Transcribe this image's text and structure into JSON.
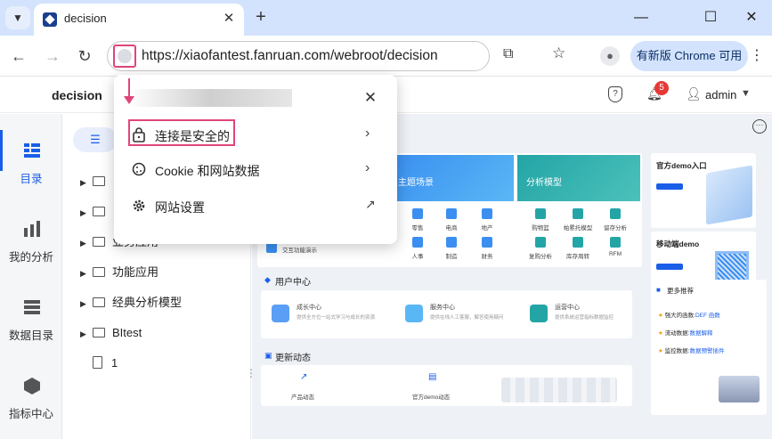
{
  "browser": {
    "tab_title": "decision",
    "url": "https://xiaofantest.fanruan.com/webroot/decision",
    "update_button": "有新版 Chrome 可用"
  },
  "app": {
    "name": "decision",
    "notification_count": "5",
    "user": "admin"
  },
  "leftnav": {
    "items": [
      {
        "label": "目录",
        "icon": "catalog-icon"
      },
      {
        "label": "我的分析",
        "icon": "analysis-icon"
      },
      {
        "label": "数据目录",
        "icon": "data-catalog-icon"
      },
      {
        "label": "指标中心",
        "icon": "metrics-icon"
      }
    ]
  },
  "tree": {
    "items": [
      {
        "label": "",
        "type": "folder"
      },
      {
        "label": "",
        "type": "folder"
      },
      {
        "label": "业务应用",
        "type": "folder"
      },
      {
        "label": "功能应用",
        "type": "folder"
      },
      {
        "label": "经典分析模型",
        "type": "folder"
      },
      {
        "label": "BItest",
        "type": "folder"
      },
      {
        "label": "1",
        "type": "file"
      }
    ]
  },
  "popup": {
    "rows": [
      {
        "label": "连接是安全的",
        "icon": "lock-icon"
      },
      {
        "label": "Cookie 和网站数据",
        "icon": "cookie-icon"
      },
      {
        "label": "网站设置",
        "icon": "gear-icon"
      }
    ]
  },
  "dashboard": {
    "banner1": {
      "title": "主题场景",
      "items": [
        "零售",
        "电商",
        "地产",
        "人事",
        "制造",
        "财务"
      ]
    },
    "banner2": {
      "title": "分析模型",
      "items": [
        "购物篮",
        "帕累托模型",
        "留存分析",
        "复购分析",
        "库存周转",
        "RFM"
      ]
    },
    "banner_bottom": "交互功能演示",
    "demo1": "官方demo入口",
    "demo2": "移动端demo",
    "user_center": {
      "title": "用户中心",
      "items": [
        {
          "title": "成长中心",
          "desc": "提供全方位一站式学习与成长的资源"
        },
        {
          "title": "服务中心",
          "desc": "提供在线人工客服，解答使用疑问"
        },
        {
          "title": "运营中心",
          "desc": "提供系统运营指标数据监控"
        }
      ]
    },
    "news": {
      "title": "更新动态",
      "items": [
        "产品动态",
        "官方demo动态"
      ]
    },
    "recommend": {
      "title": "更多推荐",
      "items": [
        {
          "prefix": "强大的函数:",
          "link": "DEF 函数"
        },
        {
          "prefix": "流动数据:",
          "link": "数据解释"
        },
        {
          "prefix": "监控数据:",
          "link": "数据预警插件"
        }
      ]
    }
  }
}
